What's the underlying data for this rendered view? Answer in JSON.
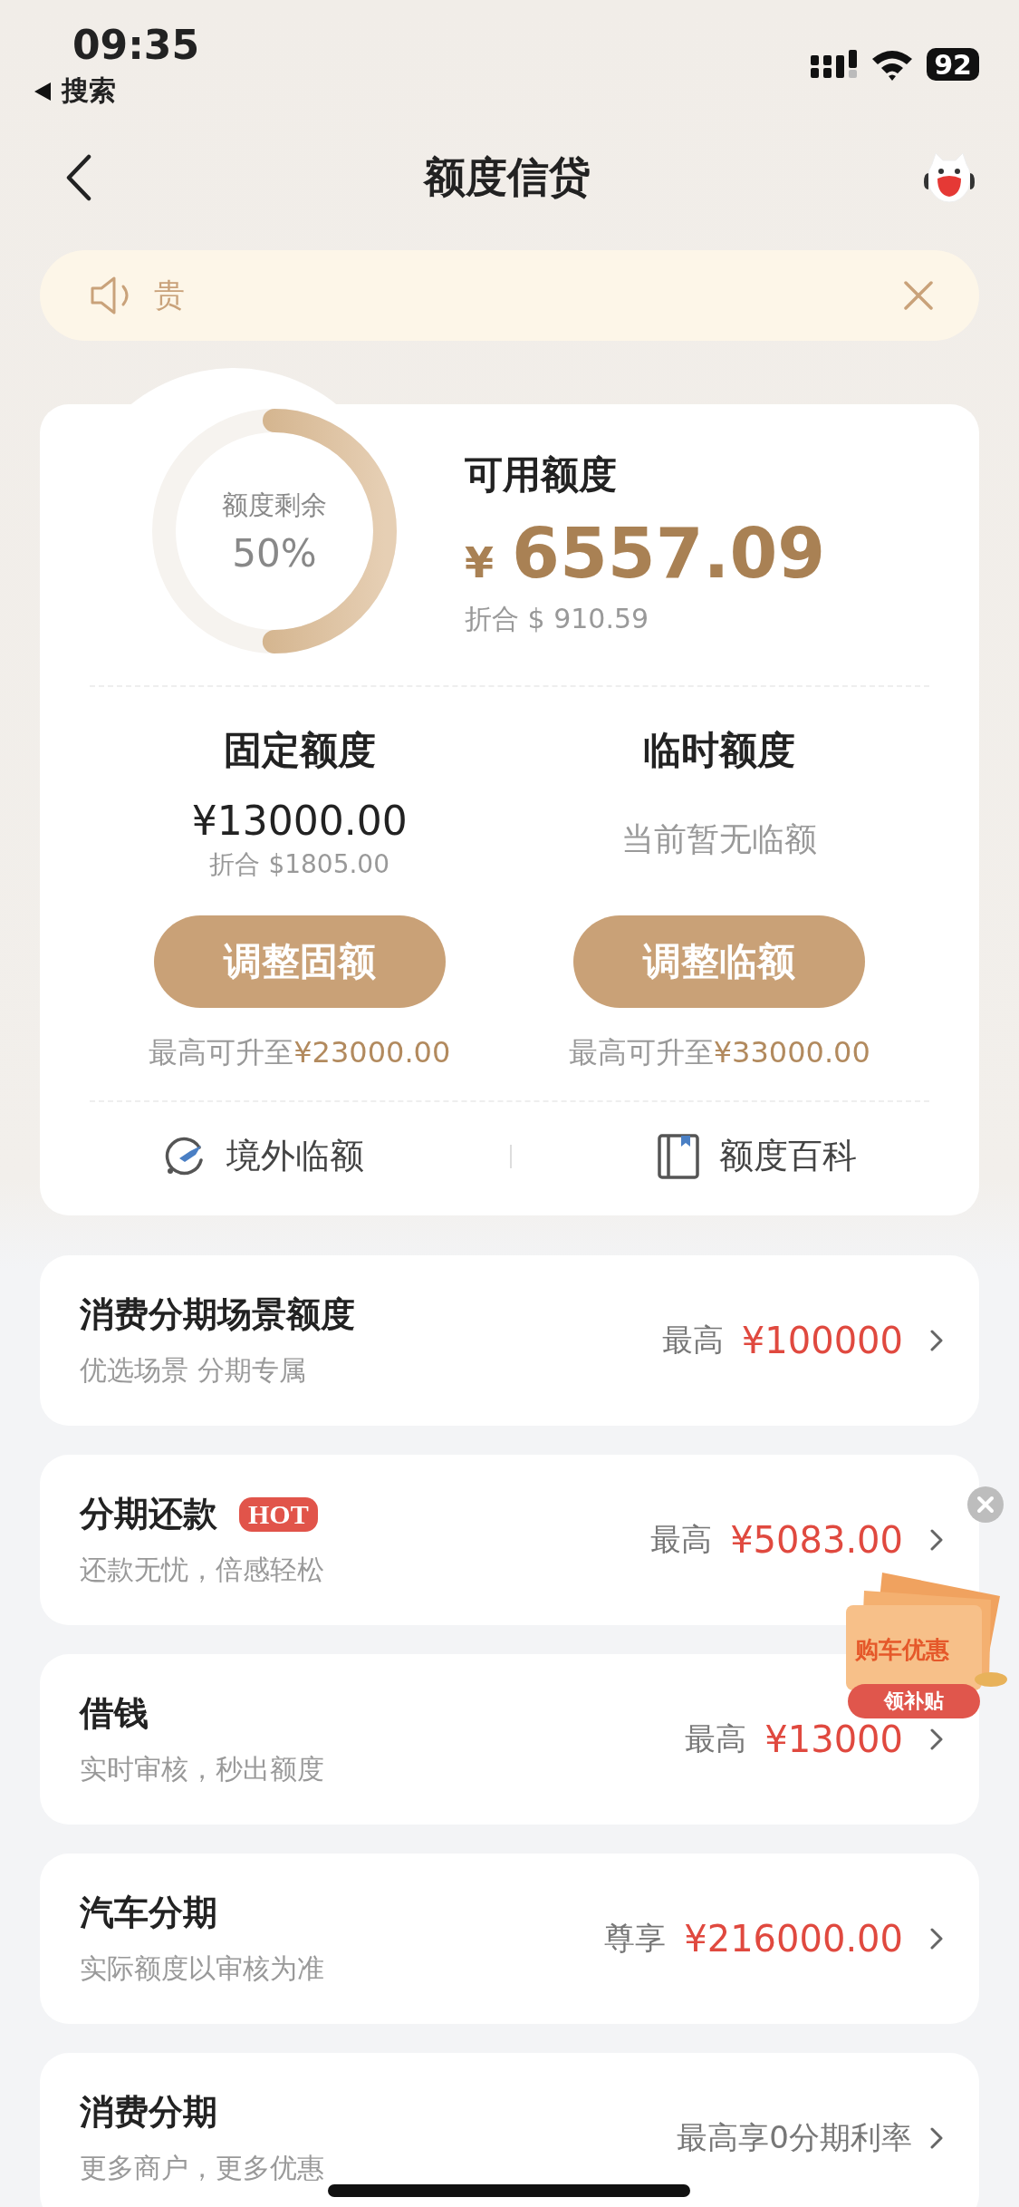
{
  "status_bar": {
    "time": "09:35",
    "back_app": "搜索",
    "battery": "92"
  },
  "nav": {
    "title": "额度信贷"
  },
  "notice": {
    "text": "贵"
  },
  "credit": {
    "ring_label": "额度剩余",
    "ring_percent": "50%",
    "title": "可用额度",
    "currency": "¥",
    "amount": "6557.09",
    "converted": "折合 $ 910.59"
  },
  "quotas": [
    {
      "title": "固定额度",
      "amount": "¥13000.00",
      "converted": "折合 $1805.00",
      "button": "调整固额",
      "limit_prefix": "最高可升至",
      "limit_value": "¥23000.00"
    },
    {
      "title": "临时额度",
      "note": "当前暂无临额",
      "button": "调整临额",
      "limit_prefix": "最高可升至",
      "limit_value": "¥33000.00"
    }
  ],
  "links": [
    {
      "label": "境外临额",
      "kind": "plane"
    },
    {
      "label": "额度百科",
      "kind": "book"
    }
  ],
  "products": [
    {
      "title": "消费分期场景额度",
      "subtitle": "优选场景 分期专属",
      "prefix": "最高",
      "value": "¥100000"
    },
    {
      "title": "分期还款",
      "badge": "HOT",
      "subtitle": "还款无忧，倍感轻松",
      "prefix": "最高",
      "value": "¥5083.00"
    },
    {
      "title": "借钱",
      "subtitle": "实时审核，秒出额度",
      "prefix": "最高",
      "value": "¥13000"
    },
    {
      "title": "汽车分期",
      "subtitle": "实际额度以审核为准",
      "prefix": "尊享",
      "value": "¥216000.00"
    },
    {
      "title": "消费分期",
      "subtitle": "更多商户，更多优惠",
      "prefix": "最高享0分期利率"
    }
  ],
  "promo": {
    "title": "购车优惠",
    "button": "领补贴"
  }
}
